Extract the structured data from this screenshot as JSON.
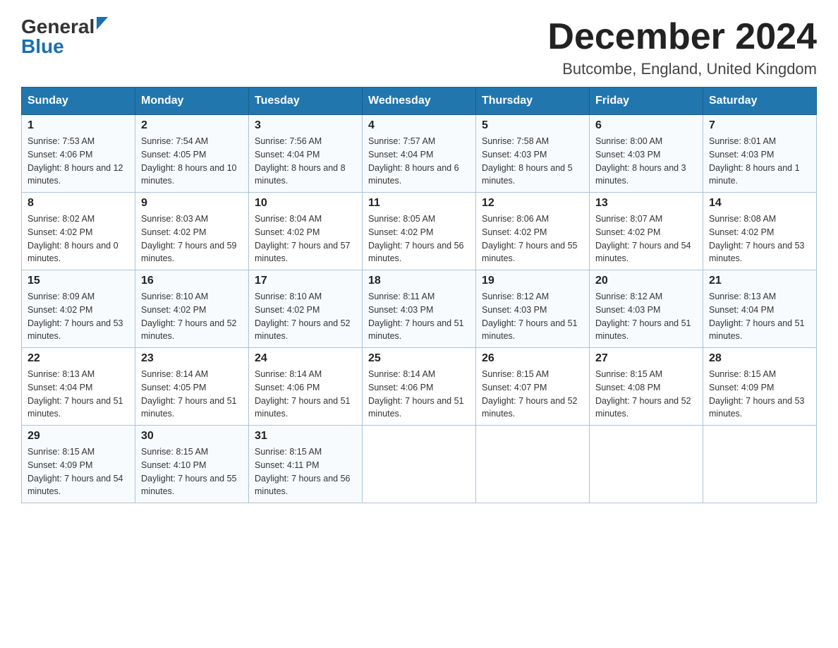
{
  "header": {
    "logo_line1": "General",
    "logo_line2": "Blue",
    "month_title": "December 2024",
    "location": "Butcombe, England, United Kingdom"
  },
  "days_of_week": [
    "Sunday",
    "Monday",
    "Tuesday",
    "Wednesday",
    "Thursday",
    "Friday",
    "Saturday"
  ],
  "weeks": [
    [
      {
        "num": "1",
        "sunrise": "7:53 AM",
        "sunset": "4:06 PM",
        "daylight": "8 hours and 12 minutes."
      },
      {
        "num": "2",
        "sunrise": "7:54 AM",
        "sunset": "4:05 PM",
        "daylight": "8 hours and 10 minutes."
      },
      {
        "num": "3",
        "sunrise": "7:56 AM",
        "sunset": "4:04 PM",
        "daylight": "8 hours and 8 minutes."
      },
      {
        "num": "4",
        "sunrise": "7:57 AM",
        "sunset": "4:04 PM",
        "daylight": "8 hours and 6 minutes."
      },
      {
        "num": "5",
        "sunrise": "7:58 AM",
        "sunset": "4:03 PM",
        "daylight": "8 hours and 5 minutes."
      },
      {
        "num": "6",
        "sunrise": "8:00 AM",
        "sunset": "4:03 PM",
        "daylight": "8 hours and 3 minutes."
      },
      {
        "num": "7",
        "sunrise": "8:01 AM",
        "sunset": "4:03 PM",
        "daylight": "8 hours and 1 minute."
      }
    ],
    [
      {
        "num": "8",
        "sunrise": "8:02 AM",
        "sunset": "4:02 PM",
        "daylight": "8 hours and 0 minutes."
      },
      {
        "num": "9",
        "sunrise": "8:03 AM",
        "sunset": "4:02 PM",
        "daylight": "7 hours and 59 minutes."
      },
      {
        "num": "10",
        "sunrise": "8:04 AM",
        "sunset": "4:02 PM",
        "daylight": "7 hours and 57 minutes."
      },
      {
        "num": "11",
        "sunrise": "8:05 AM",
        "sunset": "4:02 PM",
        "daylight": "7 hours and 56 minutes."
      },
      {
        "num": "12",
        "sunrise": "8:06 AM",
        "sunset": "4:02 PM",
        "daylight": "7 hours and 55 minutes."
      },
      {
        "num": "13",
        "sunrise": "8:07 AM",
        "sunset": "4:02 PM",
        "daylight": "7 hours and 54 minutes."
      },
      {
        "num": "14",
        "sunrise": "8:08 AM",
        "sunset": "4:02 PM",
        "daylight": "7 hours and 53 minutes."
      }
    ],
    [
      {
        "num": "15",
        "sunrise": "8:09 AM",
        "sunset": "4:02 PM",
        "daylight": "7 hours and 53 minutes."
      },
      {
        "num": "16",
        "sunrise": "8:10 AM",
        "sunset": "4:02 PM",
        "daylight": "7 hours and 52 minutes."
      },
      {
        "num": "17",
        "sunrise": "8:10 AM",
        "sunset": "4:02 PM",
        "daylight": "7 hours and 52 minutes."
      },
      {
        "num": "18",
        "sunrise": "8:11 AM",
        "sunset": "4:03 PM",
        "daylight": "7 hours and 51 minutes."
      },
      {
        "num": "19",
        "sunrise": "8:12 AM",
        "sunset": "4:03 PM",
        "daylight": "7 hours and 51 minutes."
      },
      {
        "num": "20",
        "sunrise": "8:12 AM",
        "sunset": "4:03 PM",
        "daylight": "7 hours and 51 minutes."
      },
      {
        "num": "21",
        "sunrise": "8:13 AM",
        "sunset": "4:04 PM",
        "daylight": "7 hours and 51 minutes."
      }
    ],
    [
      {
        "num": "22",
        "sunrise": "8:13 AM",
        "sunset": "4:04 PM",
        "daylight": "7 hours and 51 minutes."
      },
      {
        "num": "23",
        "sunrise": "8:14 AM",
        "sunset": "4:05 PM",
        "daylight": "7 hours and 51 minutes."
      },
      {
        "num": "24",
        "sunrise": "8:14 AM",
        "sunset": "4:06 PM",
        "daylight": "7 hours and 51 minutes."
      },
      {
        "num": "25",
        "sunrise": "8:14 AM",
        "sunset": "4:06 PM",
        "daylight": "7 hours and 51 minutes."
      },
      {
        "num": "26",
        "sunrise": "8:15 AM",
        "sunset": "4:07 PM",
        "daylight": "7 hours and 52 minutes."
      },
      {
        "num": "27",
        "sunrise": "8:15 AM",
        "sunset": "4:08 PM",
        "daylight": "7 hours and 52 minutes."
      },
      {
        "num": "28",
        "sunrise": "8:15 AM",
        "sunset": "4:09 PM",
        "daylight": "7 hours and 53 minutes."
      }
    ],
    [
      {
        "num": "29",
        "sunrise": "8:15 AM",
        "sunset": "4:09 PM",
        "daylight": "7 hours and 54 minutes."
      },
      {
        "num": "30",
        "sunrise": "8:15 AM",
        "sunset": "4:10 PM",
        "daylight": "7 hours and 55 minutes."
      },
      {
        "num": "31",
        "sunrise": "8:15 AM",
        "sunset": "4:11 PM",
        "daylight": "7 hours and 56 minutes."
      },
      null,
      null,
      null,
      null
    ]
  ]
}
